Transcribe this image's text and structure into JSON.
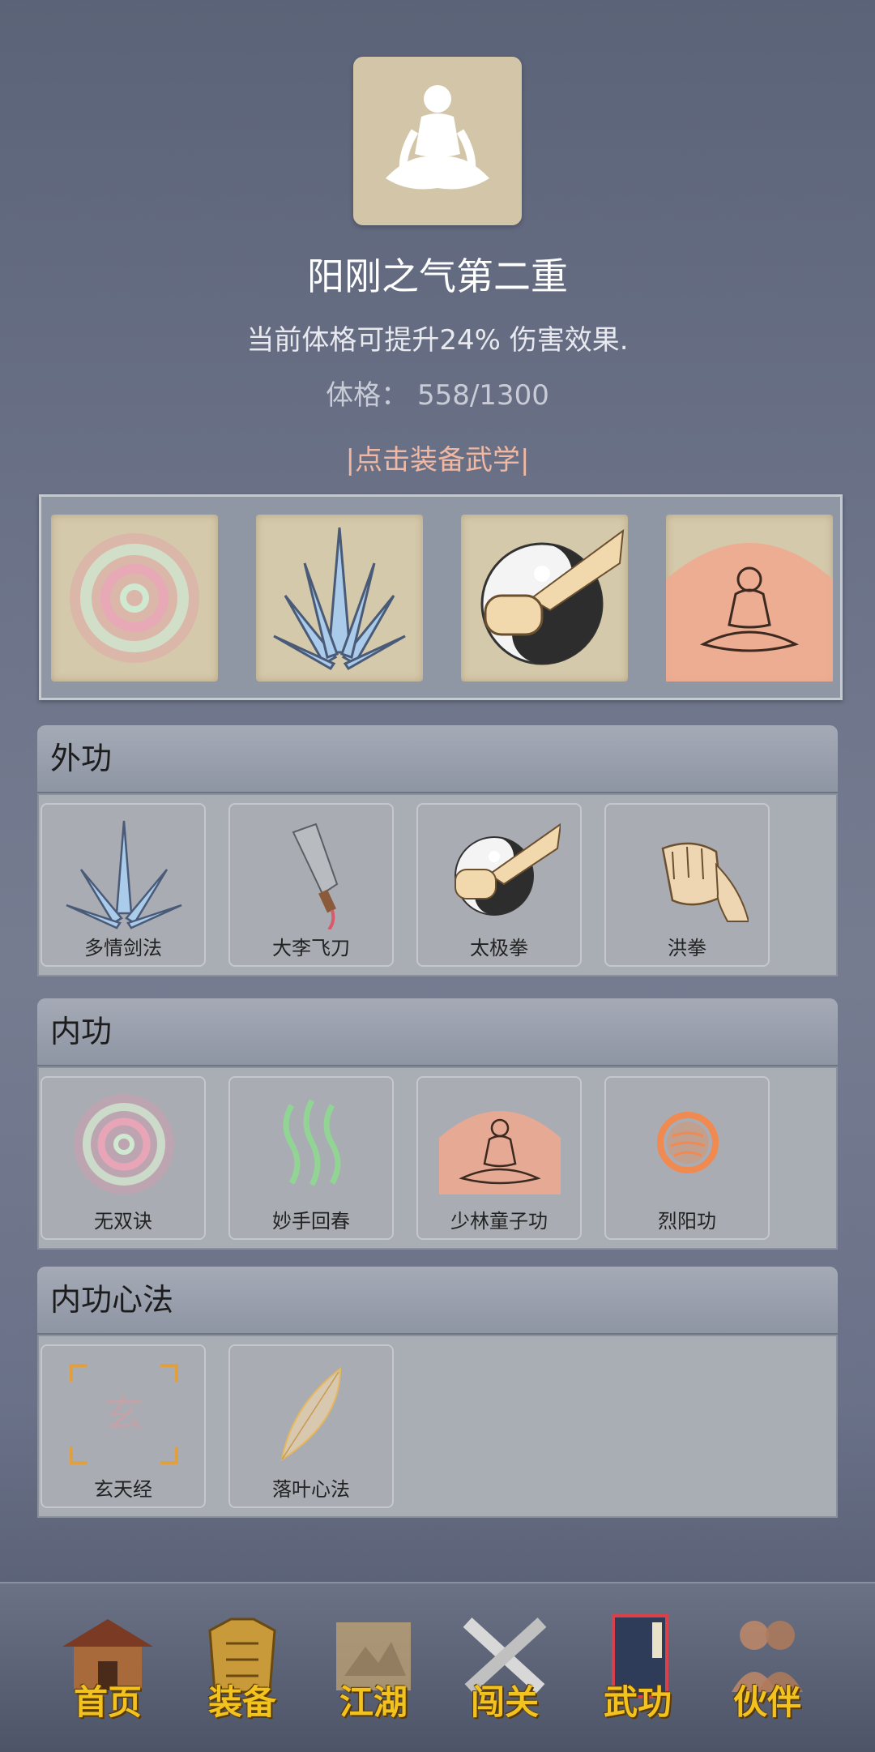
{
  "header": {
    "portrait_icon": "meditating-figure-icon",
    "title": "阳刚之气第二重",
    "description": "当前体格可提升24% 伤害效果.",
    "stat_label": "体格：",
    "stat_value": "558/1300",
    "equip_hint": "|点击装备武学|"
  },
  "equipped": [
    {
      "icon": "swirl-energy-icon"
    },
    {
      "icon": "blue-swords-icon"
    },
    {
      "icon": "taiji-fist-icon"
    },
    {
      "icon": "meditation-aura-icon"
    }
  ],
  "sections": [
    {
      "title": "外功",
      "items": [
        {
          "label": "多情剑法",
          "icon": "blue-swords-icon"
        },
        {
          "label": "大李飞刀",
          "icon": "flying-knife-icon"
        },
        {
          "label": "太极拳",
          "icon": "taiji-fist-icon"
        },
        {
          "label": "洪拳",
          "icon": "fist-icon"
        }
      ]
    },
    {
      "title": "内功",
      "items": [
        {
          "label": "无双诀",
          "icon": "swirl-energy-icon"
        },
        {
          "label": "妙手回春",
          "icon": "green-waves-icon"
        },
        {
          "label": "少林童子功",
          "icon": "meditation-aura-icon"
        },
        {
          "label": "烈阳功",
          "icon": "sun-orb-icon"
        }
      ]
    },
    {
      "title": "内功心法",
      "items": [
        {
          "label": "玄天经",
          "icon": "xuan-scroll-icon"
        },
        {
          "label": "落叶心法",
          "icon": "leaf-icon"
        }
      ]
    }
  ],
  "nav": [
    {
      "label": "首页",
      "icon": "temple-icon"
    },
    {
      "label": "装备",
      "icon": "armor-icon"
    },
    {
      "label": "江湖",
      "icon": "scroll-map-icon"
    },
    {
      "label": "闯关",
      "icon": "crossed-swords-icon"
    },
    {
      "label": "武功",
      "icon": "martial-book-icon"
    },
    {
      "label": "伙伴",
      "icon": "companions-icon"
    }
  ],
  "colors": {
    "accent_hint": "#f0b8a2",
    "nav_text": "#f2c21f",
    "parchment": "#d5c9ab"
  }
}
